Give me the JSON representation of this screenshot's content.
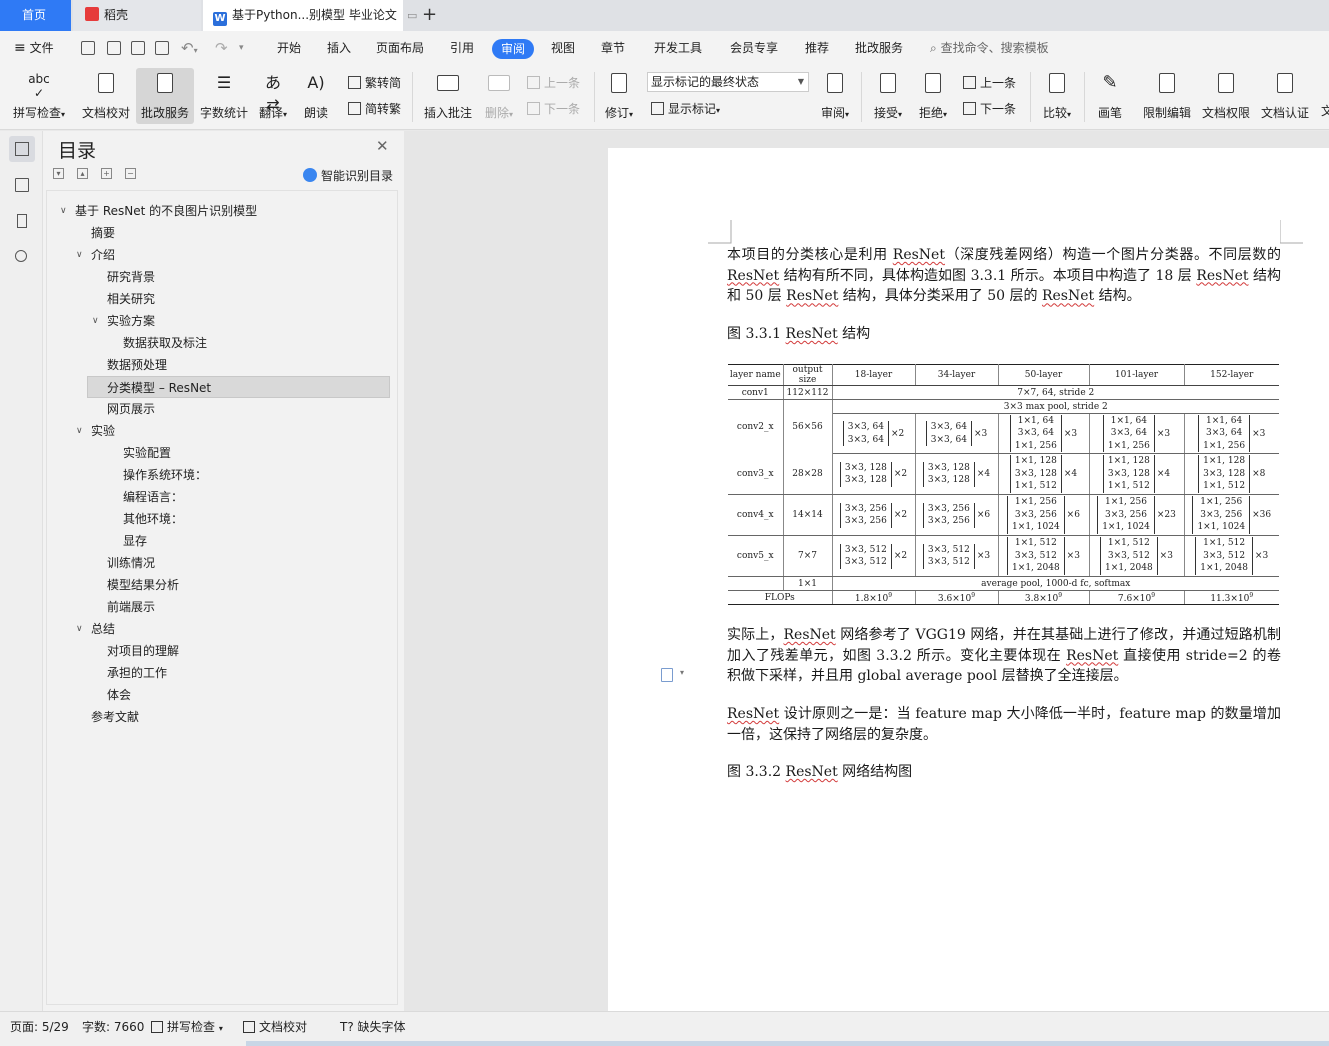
{
  "tabs": [
    {
      "label": "首页",
      "active": false
    },
    {
      "label": "稻壳",
      "active": false
    },
    {
      "label": "基于Python...别模型 毕业论文",
      "active": true
    }
  ],
  "menubar": {
    "file": "文件",
    "items": [
      "开始",
      "插入",
      "页面布局",
      "引用",
      "审阅",
      "视图",
      "章节",
      "开发工具",
      "会员专享",
      "推荐",
      "批改服务"
    ],
    "active": "审阅",
    "search": "查找命令、搜索模板"
  },
  "ribbon": {
    "spellcheck": "拼写检查",
    "proofread": "文档校对",
    "correction_service": "批改服务",
    "word_count": "字数统计",
    "translate": "翻译",
    "read_aloud": "朗读",
    "trad_to_simp": "繁转简",
    "simp_to_trad": "简转繁",
    "insert_comment": "插入批注",
    "delete": "删除",
    "prev_comment": "上一条",
    "next_comment": "下一条",
    "track_changes": "修订",
    "markup_state": "显示标记的最终状态",
    "show_markup": "显示标记",
    "review_pane": "审阅",
    "accept": "接受",
    "reject": "拒绝",
    "prev_change": "上一条",
    "next_change": "下一条",
    "compare": "比较",
    "pen": "画笔",
    "restrict_edit": "限制编辑",
    "doc_permission": "文档权限",
    "doc_certify": "文档认证",
    "overflow": "文"
  },
  "toc": {
    "title": "目录",
    "smart_button": "智能识别目录",
    "items": [
      {
        "label": "基于 ResNet 的不良图片识别模型",
        "level": 1,
        "expanded": true,
        "selected": false
      },
      {
        "label": "摘要",
        "level": 2,
        "selected": false
      },
      {
        "label": "介绍",
        "level": 2,
        "expanded": true,
        "selected": false
      },
      {
        "label": "研究背景",
        "level": 3,
        "selected": false
      },
      {
        "label": "相关研究",
        "level": 3,
        "selected": false
      },
      {
        "label": "实验方案",
        "level": 3,
        "expanded": true,
        "selected": false
      },
      {
        "label": "数据获取及标注",
        "level": 4,
        "selected": false
      },
      {
        "label": "数据预处理",
        "level": 3,
        "selected": false
      },
      {
        "label": "分类模型 – ResNet",
        "level": 3,
        "selected": true
      },
      {
        "label": "网页展示",
        "level": 3,
        "selected": false
      },
      {
        "label": "实验",
        "level": 2,
        "expanded": true,
        "selected": false
      },
      {
        "label": "实验配置",
        "level": 4,
        "selected": false
      },
      {
        "label": "操作系统环境：",
        "level": 4,
        "selected": false
      },
      {
        "label": "编程语言：",
        "level": 4,
        "selected": false
      },
      {
        "label": "其他环境：",
        "level": 4,
        "selected": false
      },
      {
        "label": "显存",
        "level": 4,
        "selected": false
      },
      {
        "label": "训练情况",
        "level": 3,
        "selected": false
      },
      {
        "label": "模型结果分析",
        "level": 3,
        "selected": false
      },
      {
        "label": "前端展示",
        "level": 3,
        "selected": false
      },
      {
        "label": "总结",
        "level": 2,
        "expanded": true,
        "selected": false
      },
      {
        "label": "对项目的理解",
        "level": 3,
        "selected": false
      },
      {
        "label": "承担的工作",
        "level": 3,
        "selected": false
      },
      {
        "label": "体会",
        "level": 3,
        "selected": false
      },
      {
        "label": "参考文献",
        "level": 2,
        "selected": false
      }
    ]
  },
  "document": {
    "para1": {
      "s1": "本项目的分类核心是利用 ",
      "s2": "ResNet",
      "s3": "（深度残差网络）构造一个图片分类器。不同层数的 ",
      "s4": "ResNet",
      "s5": " 结构有所不同，具体构造如图 3.3.1 所示。本项目中构造了 18 层 ",
      "s6": "ResNet",
      "s7": " 结构和 50 层 ",
      "s8": "ResNet",
      "s9": " 结构，具体分类采用了 50 层的 ",
      "s10": "ResNet",
      "s11": " 结构。"
    },
    "caption1": {
      "prefix": "图 3.3.1 ",
      "word": "ResNet",
      "suffix": " 结构"
    },
    "para2": {
      "s1": "实际上，",
      "s2": "ResNet",
      "s3": " 网络参考了 VGG19 网络，并在其基础上进行了修改，并通过短路机制加入了残差单元，如图 3.3.2 所示。变化主要体现在 ",
      "s4": "ResNet",
      "s5": " 直接使用 stride=2 的卷积做下采样，并且用 global average pool 层替换了全连接层。"
    },
    "para3": {
      "s1": "ResNet",
      "s2": " 设计原则之一是：当 feature map 大小降低一半时，feature map 的数量增加一倍，这保持了网络层的复杂度。"
    },
    "caption2": {
      "prefix": "图 3.3.2 ",
      "word": "ResNet",
      "suffix": " 网络结构图"
    },
    "table": {
      "headers": [
        "layer name",
        "output size",
        "18-layer",
        "34-layer",
        "50-layer",
        "101-layer",
        "152-layer"
      ],
      "conv1": {
        "name": "conv1",
        "size": "112×112",
        "spec": "7×7, 64, stride 2"
      },
      "pool": "3×3 max pool, stride 2",
      "rows": [
        {
          "name": "conv2_x",
          "size": "56×56",
          "b18": [
            "3×3, 64",
            "3×3, 64"
          ],
          "m18": "×2",
          "b34": [
            "3×3, 64",
            "3×3, 64"
          ],
          "m34": "×3",
          "b50": [
            "1×1, 64",
            "3×3, 64",
            "1×1, 256"
          ],
          "m50": "×3",
          "b101": [
            "1×1, 64",
            "3×3, 64",
            "1×1, 256"
          ],
          "m101": "×3",
          "b152": [
            "1×1, 64",
            "3×3, 64",
            "1×1, 256"
          ],
          "m152": "×3"
        },
        {
          "name": "conv3_x",
          "size": "28×28",
          "b18": [
            "3×3, 128",
            "3×3, 128"
          ],
          "m18": "×2",
          "b34": [
            "3×3, 128",
            "3×3, 128"
          ],
          "m34": "×4",
          "b50": [
            "1×1, 128",
            "3×3, 128",
            "1×1, 512"
          ],
          "m50": "×4",
          "b101": [
            "1×1, 128",
            "3×3, 128",
            "1×1, 512"
          ],
          "m101": "×4",
          "b152": [
            "1×1, 128",
            "3×3, 128",
            "1×1, 512"
          ],
          "m152": "×8"
        },
        {
          "name": "conv4_x",
          "size": "14×14",
          "b18": [
            "3×3, 256",
            "3×3, 256"
          ],
          "m18": "×2",
          "b34": [
            "3×3, 256",
            "3×3, 256"
          ],
          "m34": "×6",
          "b50": [
            "1×1, 256",
            "3×3, 256",
            "1×1, 1024"
          ],
          "m50": "×6",
          "b101": [
            "1×1, 256",
            "3×3, 256",
            "1×1, 1024"
          ],
          "m101": "×23",
          "b152": [
            "1×1, 256",
            "3×3, 256",
            "1×1, 1024"
          ],
          "m152": "×36"
        },
        {
          "name": "conv5_x",
          "size": "7×7",
          "b18": [
            "3×3, 512",
            "3×3, 512"
          ],
          "m18": "×2",
          "b34": [
            "3×3, 512",
            "3×3, 512"
          ],
          "m34": "×3",
          "b50": [
            "1×1, 512",
            "3×3, 512",
            "1×1, 2048"
          ],
          "m50": "×3",
          "b101": [
            "1×1, 512",
            "3×3, 512",
            "1×1, 2048"
          ],
          "m101": "×3",
          "b152": [
            "1×1, 512",
            "3×3, 512",
            "1×1, 2048"
          ],
          "m152": "×3"
        }
      ],
      "final": {
        "size": "1×1",
        "spec": "average pool, 1000-d fc, softmax"
      },
      "flops": {
        "label": "FLOPs",
        "values": [
          {
            "base": "1.8×10",
            "exp": "9"
          },
          {
            "base": "3.6×10",
            "exp": "9"
          },
          {
            "base": "3.8×10",
            "exp": "9"
          },
          {
            "base": "7.6×10",
            "exp": "9"
          },
          {
            "base": "11.3×10",
            "exp": "9"
          }
        ]
      }
    }
  },
  "statusbar": {
    "page": "页面: 5/29",
    "words": "字数: 7660",
    "spellcheck": "拼写检查",
    "proofread": "文档校对",
    "missing_fonts": "缺失字体"
  },
  "colors": {
    "accent": "#2f7af5",
    "spell_underline": "#d23a3a"
  }
}
